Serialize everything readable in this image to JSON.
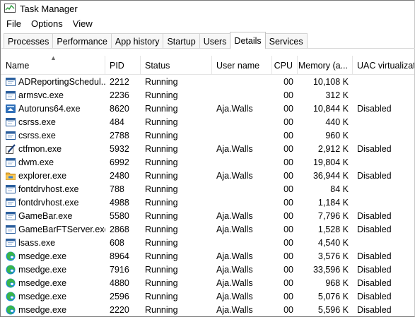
{
  "window": {
    "title": "Task Manager"
  },
  "menu": [
    "File",
    "Options",
    "View"
  ],
  "tabs": [
    {
      "label": "Processes",
      "active": false
    },
    {
      "label": "Performance",
      "active": false
    },
    {
      "label": "App history",
      "active": false
    },
    {
      "label": "Startup",
      "active": false
    },
    {
      "label": "Users",
      "active": false
    },
    {
      "label": "Details",
      "active": true
    },
    {
      "label": "Services",
      "active": false
    }
  ],
  "columns": {
    "name": "Name",
    "pid": "PID",
    "status": "Status",
    "user": "User name",
    "cpu": "CPU",
    "memory": "Memory (a...",
    "uac": "UAC virtualizat..."
  },
  "colors": {
    "edge_blue": "#1b8ad6",
    "edge_green": "#39b54a",
    "folder": "#f2b53a",
    "autoruns_blue": "#2f6fb8"
  },
  "rows": [
    {
      "name": "ADReportingSchedul...",
      "icon": "window-icon",
      "pid": "2212",
      "status": "Running",
      "user": "",
      "cpu": "00",
      "memory": "10,108 K",
      "uac": ""
    },
    {
      "name": "armsvc.exe",
      "icon": "window-icon",
      "pid": "2236",
      "status": "Running",
      "user": "",
      "cpu": "00",
      "memory": "312 K",
      "uac": ""
    },
    {
      "name": "Autoruns64.exe",
      "icon": "autoruns-icon",
      "pid": "8620",
      "status": "Running",
      "user": "Aja.Walls",
      "cpu": "00",
      "memory": "10,844 K",
      "uac": "Disabled"
    },
    {
      "name": "csrss.exe",
      "icon": "window-icon",
      "pid": "484",
      "status": "Running",
      "user": "",
      "cpu": "00",
      "memory": "440 K",
      "uac": ""
    },
    {
      "name": "csrss.exe",
      "icon": "window-icon",
      "pid": "2788",
      "status": "Running",
      "user": "",
      "cpu": "00",
      "memory": "960 K",
      "uac": ""
    },
    {
      "name": "ctfmon.exe",
      "icon": "pen-icon",
      "pid": "5932",
      "status": "Running",
      "user": "Aja.Walls",
      "cpu": "00",
      "memory": "2,912 K",
      "uac": "Disabled"
    },
    {
      "name": "dwm.exe",
      "icon": "window-icon",
      "pid": "6992",
      "status": "Running",
      "user": "",
      "cpu": "00",
      "memory": "19,804 K",
      "uac": ""
    },
    {
      "name": "explorer.exe",
      "icon": "folder-icon",
      "pid": "2480",
      "status": "Running",
      "user": "Aja.Walls",
      "cpu": "00",
      "memory": "36,944 K",
      "uac": "Disabled"
    },
    {
      "name": "fontdrvhost.exe",
      "icon": "window-icon",
      "pid": "788",
      "status": "Running",
      "user": "",
      "cpu": "00",
      "memory": "84 K",
      "uac": ""
    },
    {
      "name": "fontdrvhost.exe",
      "icon": "window-icon",
      "pid": "4988",
      "status": "Running",
      "user": "",
      "cpu": "00",
      "memory": "1,184 K",
      "uac": ""
    },
    {
      "name": "GameBar.exe",
      "icon": "window-icon",
      "pid": "5580",
      "status": "Running",
      "user": "Aja.Walls",
      "cpu": "00",
      "memory": "7,796 K",
      "uac": "Disabled"
    },
    {
      "name": "GameBarFTServer.exe",
      "icon": "window-icon",
      "pid": "2868",
      "status": "Running",
      "user": "Aja.Walls",
      "cpu": "00",
      "memory": "1,528 K",
      "uac": "Disabled"
    },
    {
      "name": "lsass.exe",
      "icon": "window-icon",
      "pid": "608",
      "status": "Running",
      "user": "",
      "cpu": "00",
      "memory": "4,540 K",
      "uac": ""
    },
    {
      "name": "msedge.exe",
      "icon": "edge-icon",
      "pid": "8964",
      "status": "Running",
      "user": "Aja.Walls",
      "cpu": "00",
      "memory": "3,576 K",
      "uac": "Disabled"
    },
    {
      "name": "msedge.exe",
      "icon": "edge-icon",
      "pid": "7916",
      "status": "Running",
      "user": "Aja.Walls",
      "cpu": "00",
      "memory": "33,596 K",
      "uac": "Disabled"
    },
    {
      "name": "msedge.exe",
      "icon": "edge-icon",
      "pid": "4880",
      "status": "Running",
      "user": "Aja.Walls",
      "cpu": "00",
      "memory": "968 K",
      "uac": "Disabled"
    },
    {
      "name": "msedge.exe",
      "icon": "edge-icon",
      "pid": "2596",
      "status": "Running",
      "user": "Aja.Walls",
      "cpu": "00",
      "memory": "5,076 K",
      "uac": "Disabled"
    },
    {
      "name": "msedge.exe",
      "icon": "edge-icon",
      "pid": "2220",
      "status": "Running",
      "user": "Aja.Walls",
      "cpu": "00",
      "memory": "5,596 K",
      "uac": "Disabled"
    }
  ]
}
